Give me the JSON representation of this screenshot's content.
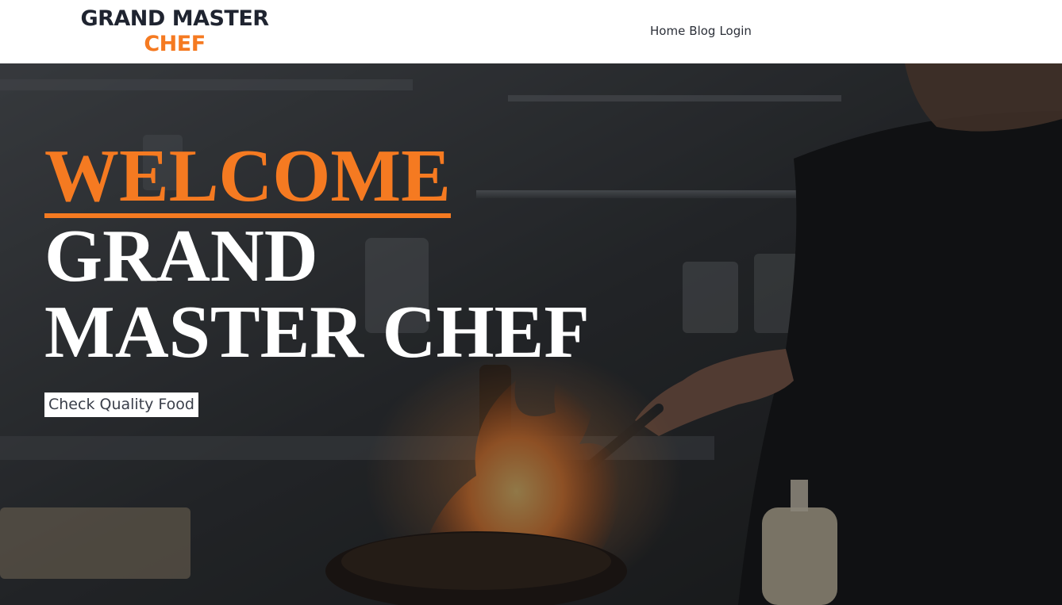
{
  "brand": {
    "line1": "GRAND MASTER",
    "line2": "CHEF"
  },
  "nav": {
    "items": [
      "Home",
      "Blog",
      "Login"
    ]
  },
  "hero": {
    "welcome": "WELCOME",
    "title_line1": "GRAND",
    "title_line2": "MASTER CHEF",
    "cta_label": "Check Quality Food"
  },
  "colors": {
    "accent": "#f57a21",
    "brand_dark": "#1f2430",
    "nav_text": "#2b2f38",
    "hero_text": "#ffffff"
  }
}
